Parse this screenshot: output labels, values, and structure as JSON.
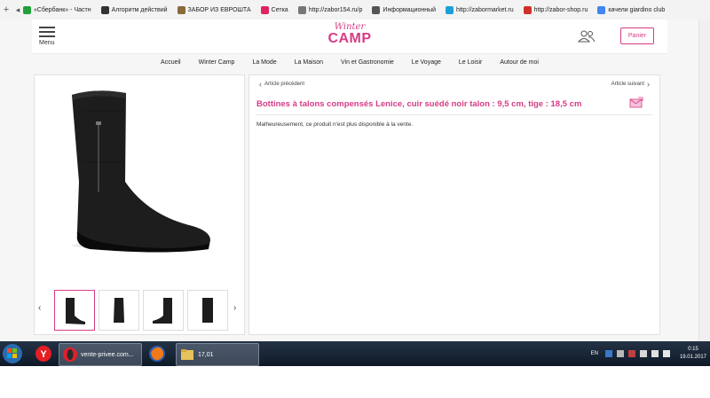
{
  "bookmarks": [
    {
      "label": "«Сбербанк» - Частн",
      "color": "#21a038"
    },
    {
      "label": "Алгоритм действий",
      "color": "#333333"
    },
    {
      "label": "ЗАБОР ИЗ ЕВРОШТА",
      "color": "#8a6a3a"
    },
    {
      "label": "Сетка",
      "color": "#e0245e"
    },
    {
      "label": "http://zabor154.ru/p",
      "color": "#777777"
    },
    {
      "label": "Информационный",
      "color": "#555555"
    },
    {
      "label": "http://zabormarket.ru",
      "color": "#1ca0d8"
    },
    {
      "label": "http://zabor-shop.ru",
      "color": "#d0302a"
    },
    {
      "label": "качели giardino club",
      "color": "#4285f4"
    }
  ],
  "header": {
    "menu_label": "Menu",
    "logo_top": "Winter",
    "logo_bottom": "CAMP",
    "cart_label": "Panier"
  },
  "nav": [
    "Accueil",
    "Winter Camp",
    "La Mode",
    "La Maison",
    "Vin et Gastronomie",
    "Le Voyage",
    "Le Loisir",
    "Autour de moi"
  ],
  "product": {
    "prev_label": "Article précédent",
    "next_label": "Article suivant",
    "title": "Bottines à talons compensés Lenice, cuir suédé noir talon : 9,5 cm, tige : 18,5 cm",
    "message": "Malheureusement, ce produit n'est plus disponible à la vente.",
    "thumb_count": 4,
    "active_thumb": 1
  },
  "taskbar": {
    "buttons": [
      {
        "label": "",
        "icon": "yandex-browser-icon"
      },
      {
        "label": "vente-privee.com...",
        "icon": "opera-icon"
      },
      {
        "label": "",
        "icon": "firefox-icon"
      },
      {
        "label": "17,01",
        "icon": "folder-icon"
      }
    ],
    "lang": "EN",
    "time": "0:15",
    "date": "19.01.2017"
  },
  "colors": {
    "accent": "#d63c86"
  }
}
